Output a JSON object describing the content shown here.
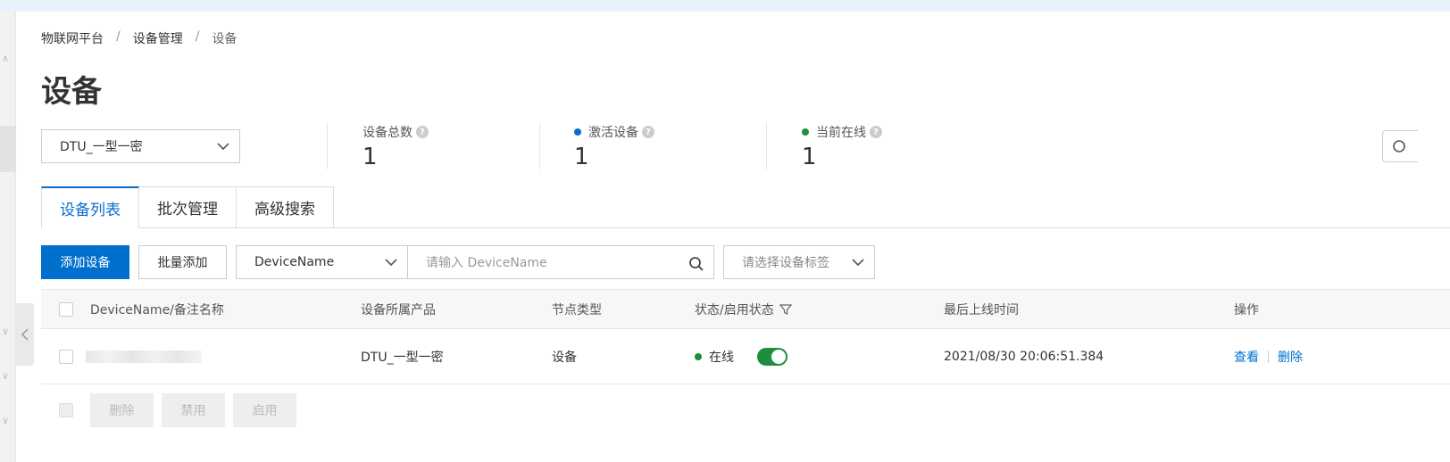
{
  "breadcrumb": {
    "items": [
      "物联网平台",
      "设备管理",
      "设备"
    ],
    "separator": "/"
  },
  "page": {
    "title": "设备"
  },
  "product_select": {
    "value": "DTU_一型一密"
  },
  "stats": [
    {
      "label": "设备总数",
      "value": "1",
      "dot_color": ""
    },
    {
      "label": "激活设备",
      "value": "1",
      "dot_color": "#0a6ccf"
    },
    {
      "label": "当前在线",
      "value": "1",
      "dot_color": "#1e8e3e"
    }
  ],
  "tabs": [
    "设备列表",
    "批次管理",
    "高级搜索"
  ],
  "toolbar": {
    "add_label": "添加设备",
    "batch_add_label": "批量添加",
    "field_value": "DeviceName",
    "search_placeholder": "请输入 DeviceName",
    "tag_placeholder": "请选择设备标签"
  },
  "table": {
    "headers": [
      "DeviceName/备注名称",
      "设备所属产品",
      "节点类型",
      "状态/启用状态",
      "最后上线时间",
      "操作"
    ],
    "rows": [
      {
        "product": "DTU_一型一密",
        "node_type": "设备",
        "status": "在线",
        "enabled": true,
        "last_online": "2021/08/30 20:06:51.384",
        "actions": [
          "查看",
          "删除"
        ]
      }
    ]
  },
  "bulk_actions": [
    "删除",
    "禁用",
    "启用"
  ],
  "colors": {
    "primary": "#0070cc",
    "online": "#1e8e3e",
    "active": "#0a6ccf"
  }
}
